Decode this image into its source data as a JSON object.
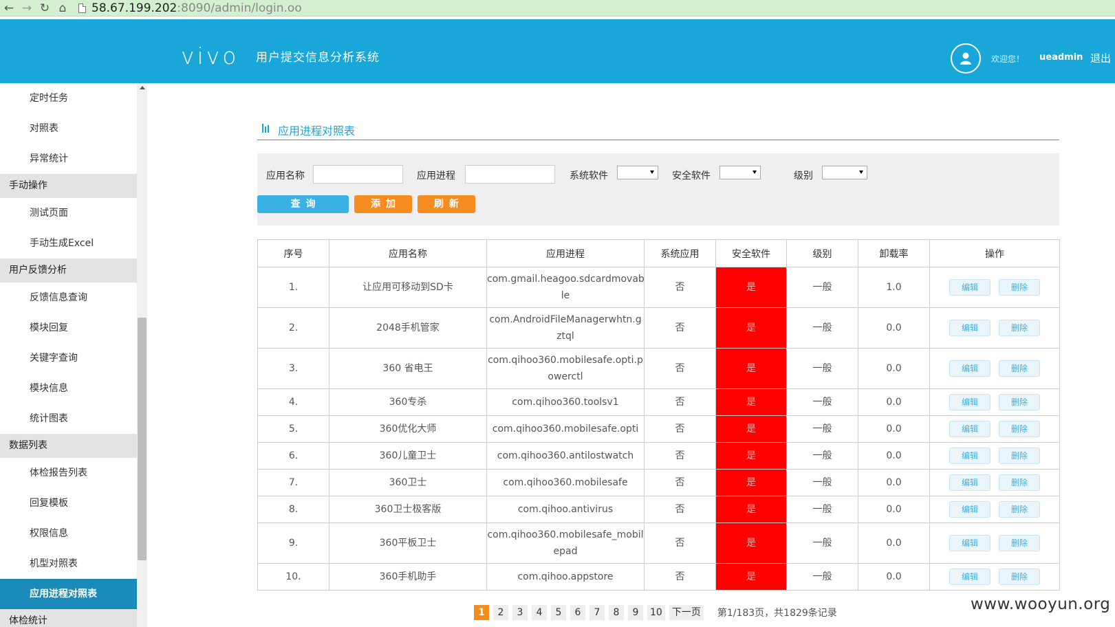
{
  "browser": {
    "url_host": "58.67.199.202",
    "url_port": ":8090",
    "url_path": "/admin/login.oo"
  },
  "header": {
    "logo": "vivo",
    "system_title": "用户提交信息分析系统",
    "welcome": "欢迎您！",
    "username": "ueadmin",
    "logout": "退出"
  },
  "sidebar": {
    "items": [
      {
        "type": "item",
        "label": "定时任务"
      },
      {
        "type": "item",
        "label": "对照表"
      },
      {
        "type": "item",
        "label": "异常统计"
      },
      {
        "type": "group",
        "label": "手动操作"
      },
      {
        "type": "item",
        "label": "测试页面"
      },
      {
        "type": "item",
        "label": "手动生成Excel"
      },
      {
        "type": "group",
        "label": "用户反馈分析"
      },
      {
        "type": "item",
        "label": "反馈信息查询"
      },
      {
        "type": "item",
        "label": "模块回复"
      },
      {
        "type": "item",
        "label": "关键字查询"
      },
      {
        "type": "item",
        "label": "模块信息"
      },
      {
        "type": "item",
        "label": "统计图表"
      },
      {
        "type": "group",
        "label": "数据列表"
      },
      {
        "type": "item",
        "label": "体检报告列表"
      },
      {
        "type": "item",
        "label": "回复模板"
      },
      {
        "type": "item",
        "label": "权限信息"
      },
      {
        "type": "item",
        "label": "机型对照表"
      },
      {
        "type": "item",
        "label": "应用进程对照表",
        "active": true
      },
      {
        "type": "group",
        "label": "体检统计"
      }
    ]
  },
  "main": {
    "section_title": "应用进程对照表",
    "filters": {
      "app_name_label": "应用名称",
      "app_name_value": "",
      "process_label": "应用进程",
      "process_value": "",
      "system_soft_label": "系统软件",
      "security_soft_label": "安全软件",
      "level_label": "级别"
    },
    "buttons": {
      "query": "查询",
      "add": "添加",
      "refresh": "刷新"
    },
    "table": {
      "headers": [
        "序号",
        "应用名称",
        "应用进程",
        "系统应用",
        "安全软件",
        "级别",
        "卸载率",
        "操作"
      ],
      "edit_label": "编辑",
      "delete_label": "删除",
      "rows": [
        {
          "no": "1.",
          "name": "让应用可移动到SD卡",
          "process": [
            "com.gmail.heagoo.sdcardmovab",
            "le"
          ],
          "system": "否",
          "security": "是",
          "level": "一般",
          "uninstall": "1.0"
        },
        {
          "no": "2.",
          "name": "2048手机管家",
          "process": [
            "com.AndroidFileManagerwhtn.g",
            "ztql"
          ],
          "system": "否",
          "security": "是",
          "level": "一般",
          "uninstall": "0.0"
        },
        {
          "no": "3.",
          "name": "360 省电王",
          "process": [
            "com.qihoo360.mobilesafe.opti.p",
            "owerctl"
          ],
          "system": "否",
          "security": "是",
          "level": "一般",
          "uninstall": "0.0"
        },
        {
          "no": "4.",
          "name": "360专杀",
          "process": [
            "com.qihoo360.toolsv1"
          ],
          "system": "否",
          "security": "是",
          "level": "一般",
          "uninstall": "0.0"
        },
        {
          "no": "5.",
          "name": "360优化大师",
          "process": [
            "com.qihoo360.mobilesafe.opti"
          ],
          "system": "否",
          "security": "是",
          "level": "一般",
          "uninstall": "0.0"
        },
        {
          "no": "6.",
          "name": "360儿童卫士",
          "process": [
            "com.qihoo360.antilostwatch"
          ],
          "system": "否",
          "security": "是",
          "level": "一般",
          "uninstall": "0.0"
        },
        {
          "no": "7.",
          "name": "360卫士",
          "process": [
            "com.qihoo360.mobilesafe"
          ],
          "system": "否",
          "security": "是",
          "level": "一般",
          "uninstall": "0.0"
        },
        {
          "no": "8.",
          "name": "360卫士极客版",
          "process": [
            "com.qihoo.antivirus"
          ],
          "system": "否",
          "security": "是",
          "level": "一般",
          "uninstall": "0.0"
        },
        {
          "no": "9.",
          "name": "360平板卫士",
          "process": [
            "com.qihoo360.mobilesafe_mobil",
            "epad"
          ],
          "system": "否",
          "security": "是",
          "level": "一般",
          "uninstall": "0.0"
        },
        {
          "no": "10.",
          "name": "360手机助手",
          "process": [
            "com.qihoo.appstore"
          ],
          "system": "否",
          "security": "是",
          "level": "一般",
          "uninstall": "0.0"
        }
      ]
    },
    "pagination": {
      "pages": [
        "1",
        "2",
        "3",
        "4",
        "5",
        "6",
        "7",
        "8",
        "9",
        "10"
      ],
      "current": "1",
      "next_label": "下一页",
      "info": "第1/183页，共1829条记录"
    }
  },
  "watermark": "www.wooyun.org",
  "colors": {
    "header_bg": "#19a6d9",
    "active_sidebar": "#1a8bb8",
    "accent_orange": "#f68b1f",
    "security_cell": "#ff0000"
  }
}
